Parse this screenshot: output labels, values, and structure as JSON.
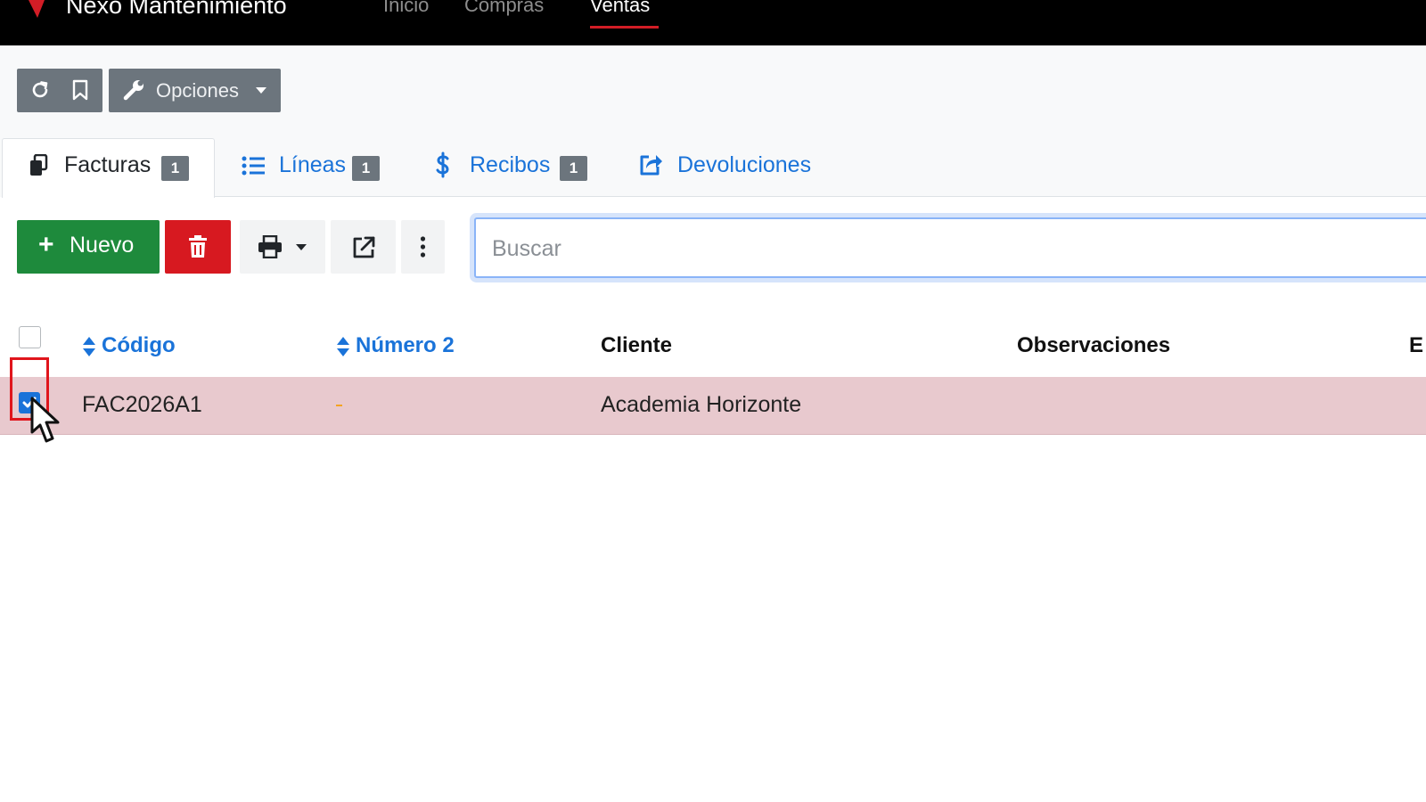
{
  "navbar": {
    "brand": "Nexo Mantenimiento",
    "links": [
      {
        "label": "Inicio",
        "active": false
      },
      {
        "label": "Compras",
        "active": false
      },
      {
        "label": "Ventas",
        "active": true
      }
    ]
  },
  "toolbar": {
    "refresh_icon": "refresh-icon",
    "bookmark_icon": "bookmark-icon",
    "options_label": "Opciones"
  },
  "tabs": [
    {
      "label": "Facturas",
      "badge": "1",
      "icon": "copy-icon",
      "active": true
    },
    {
      "label": "Líneas",
      "badge": "1",
      "icon": "list-icon",
      "active": false
    },
    {
      "label": "Recibos",
      "badge": "1",
      "icon": "dollar-icon",
      "active": false
    },
    {
      "label": "Devoluciones",
      "icon": "share-icon",
      "active": false
    }
  ],
  "actions": {
    "new_label": "Nuevo",
    "delete_icon": "trash-icon",
    "print_icon": "print-icon",
    "export_icon": "external-link-icon",
    "more_icon": "vertical-dots-icon"
  },
  "search": {
    "placeholder": "Buscar",
    "value": ""
  },
  "table": {
    "columns": [
      "Código",
      "Número 2",
      "Cliente",
      "Observaciones",
      "E"
    ],
    "rows": [
      {
        "codigo": "FAC2026A1",
        "numero2": "-",
        "cliente": "Academia Horizonte",
        "observaciones": "",
        "selected": true
      }
    ]
  },
  "colors": {
    "accent": "#1a73d9",
    "success": "#1e8a3c",
    "danger": "#d71920",
    "selected_row": "#e8c9ce",
    "nav_active": "#d21d26"
  }
}
